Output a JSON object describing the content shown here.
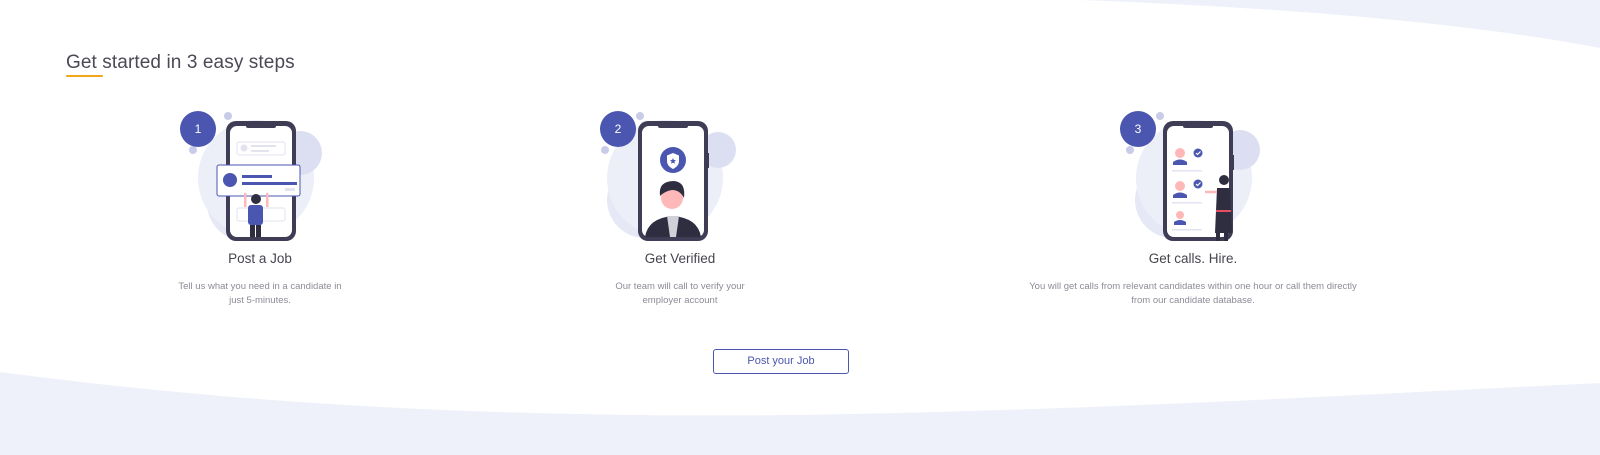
{
  "heading": "Get started in 3 easy steps",
  "steps": [
    {
      "number": "1",
      "title": "Post a Job",
      "description": "Tell us what you need in a candidate in just 5-minutes."
    },
    {
      "number": "2",
      "title": "Get Verified",
      "description": "Our team will call to verify your employer account"
    },
    {
      "number": "3",
      "title": "Get calls. Hire.",
      "description": "You will get calls from relevant candidates within one hour or call them directly from our candidate database."
    }
  ],
  "cta": {
    "label": "Post your Job"
  },
  "colors": {
    "brand": "#4b56b0",
    "accent_underline": "#f2a71b",
    "background_wave": "#eef1f9"
  },
  "icons": [
    "phone-post-job-illustration",
    "phone-verify-illustration",
    "phone-calls-illustration",
    "shield-icon",
    "check-icon"
  ]
}
